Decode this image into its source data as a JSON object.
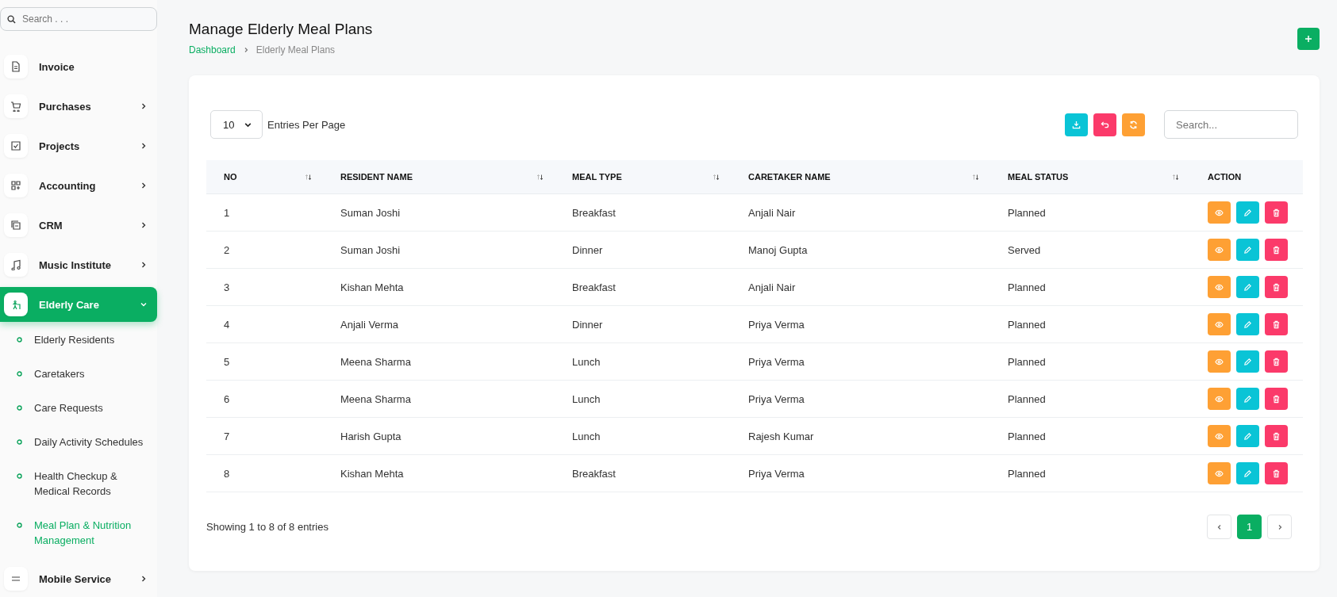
{
  "sidebar": {
    "search": {
      "placeholder": "Search . . ."
    },
    "items": [
      {
        "label": "Invoice",
        "kind": "link",
        "selected": false
      },
      {
        "label": "Purchases",
        "kind": "group",
        "selected": false,
        "expanded": false
      },
      {
        "label": "Projects",
        "kind": "group",
        "selected": false,
        "expanded": false
      },
      {
        "label": "Accounting",
        "kind": "group",
        "selected": false,
        "expanded": false
      },
      {
        "label": "CRM",
        "kind": "group",
        "selected": false,
        "expanded": false
      },
      {
        "label": "Music Institute",
        "kind": "group",
        "selected": false,
        "expanded": false
      },
      {
        "label": "Elderly Care",
        "kind": "group",
        "selected": true,
        "expanded": true,
        "children": [
          {
            "label": "Elderly Residents",
            "selected": false
          },
          {
            "label": "Caretakers",
            "selected": false
          },
          {
            "label": "Care Requests",
            "selected": false
          },
          {
            "label": "Daily Activity Schedules",
            "selected": false
          },
          {
            "label": "Health Checkup & Medical Records",
            "selected": false
          },
          {
            "label": "Meal Plan & Nutrition Management",
            "selected": true
          }
        ]
      },
      {
        "label": "Mobile Service",
        "kind": "group",
        "selected": false,
        "expanded": false
      }
    ]
  },
  "page": {
    "title": "Manage Elderly Meal Plans",
    "breadcrumb": [
      "Dashboard",
      "Elderly Meal Plans"
    ]
  },
  "toolbar": {
    "page_size": "10",
    "page_size_label": "Entries Per Page",
    "search": {
      "placeholder": "Search..."
    }
  },
  "table": {
    "columns": [
      {
        "label": "NO",
        "sortable": true
      },
      {
        "label": "RESIDENT NAME",
        "sortable": true
      },
      {
        "label": "MEAL TYPE",
        "sortable": true
      },
      {
        "label": "CARETAKER NAME",
        "sortable": true
      },
      {
        "label": "MEAL STATUS",
        "sortable": true
      },
      {
        "label": "ACTION",
        "sortable": false
      }
    ],
    "rows": [
      [
        "1",
        "Suman Joshi",
        "Breakfast",
        "Anjali Nair",
        "Planned"
      ],
      [
        "2",
        "Suman Joshi",
        "Dinner",
        "Manoj Gupta",
        "Served"
      ],
      [
        "3",
        "Kishan Mehta",
        "Breakfast",
        "Anjali Nair",
        "Planned"
      ],
      [
        "4",
        "Anjali Verma",
        "Dinner",
        "Priya Verma",
        "Planned"
      ],
      [
        "5",
        "Meena Sharma",
        "Lunch",
        "Priya Verma",
        "Planned"
      ],
      [
        "6",
        "Meena Sharma",
        "Lunch",
        "Priya Verma",
        "Planned"
      ],
      [
        "7",
        "Harish Gupta",
        "Lunch",
        "Rajesh Kumar",
        "Planned"
      ],
      [
        "8",
        "Kishan Mehta",
        "Breakfast",
        "Priya Verma",
        "Planned"
      ]
    ]
  },
  "footer": {
    "summary": "Showing 1 to 8 of 8 entries",
    "pages": [
      {
        "label": "1",
        "selected": true
      }
    ]
  }
}
